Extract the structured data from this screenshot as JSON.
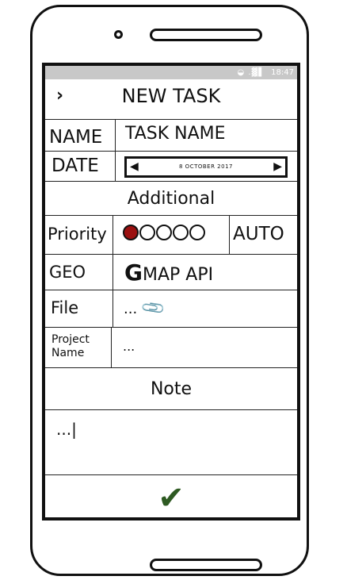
{
  "status_bar": {
    "icons": "◒ .▓▌",
    "time": "18:47"
  },
  "header": {
    "back_glyph": "›",
    "title": "NEW TASK"
  },
  "form": {
    "name_label": "NAME",
    "name_value": "TASK NAME",
    "date_label": "DATE",
    "date_value": "8 OCTOBER 2017",
    "date_prev_glyph": "◀",
    "date_next_glyph": "▶"
  },
  "additional": {
    "section_title": "Additional",
    "priority_label": "Priority",
    "priority_level": 1,
    "priority_max": 5,
    "priority_auto_label": "AUTO",
    "geo_label": "GEO",
    "geo_logo_letter": "G",
    "geo_value": "MAP API",
    "file_label": "File",
    "file_value": "...",
    "file_icon": "paperclip-icon",
    "project_label_line1": "Project",
    "project_label_line2": "Name",
    "project_value": "..."
  },
  "note": {
    "section_title": "Note",
    "text": "...|"
  },
  "footer": {
    "confirm_icon": "checkmark-icon",
    "confirm_color": "#2e5a22"
  },
  "colors": {
    "priority_fill": "#9b1010",
    "statusbar_bg": "#c8c8c8"
  }
}
